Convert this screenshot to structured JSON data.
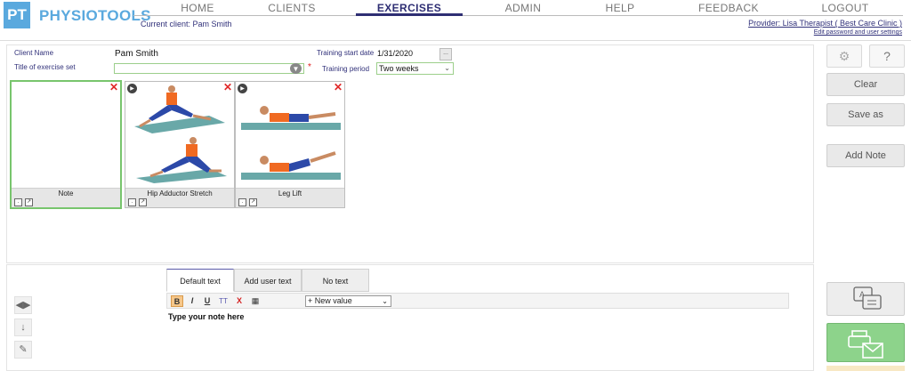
{
  "brand": {
    "logo_mark": "PT",
    "name": "PHYSIOTOOLS"
  },
  "nav": {
    "items": [
      "HOME",
      "CLIENTS",
      "EXERCISES",
      "ADMIN",
      "HELP",
      "FEEDBACK",
      "LOGOUT"
    ],
    "active": "EXERCISES"
  },
  "header": {
    "current_client": "Current client: Pam Smith",
    "provider": "Provider: Lisa Therapist ( Best Care Clinic )",
    "edit_link": "Edit password and user settings"
  },
  "form": {
    "client_name_label": "Client Name",
    "client_name_value": "Pam  Smith",
    "title_label": "Title of exercise set",
    "title_value": "",
    "required_mark": "*",
    "training_start_label": "Training start date",
    "training_start_value": "1/31/2020",
    "date_button": "...",
    "training_period_label": "Training period",
    "training_period_value": "Two weeks"
  },
  "cards": [
    {
      "caption": "Note"
    },
    {
      "caption": "Hip Adductor Stretch"
    },
    {
      "caption": "Leg Lift"
    }
  ],
  "right_buttons": {
    "clear": "Clear",
    "save_as": "Save as",
    "add_note": "Add Note"
  },
  "editor": {
    "tabs": [
      "Default text",
      "Add user text",
      "No text"
    ],
    "active_tab": "Default text",
    "toolbar": {
      "bold": "B",
      "italic": "I",
      "underline": "U",
      "font_size": "TT",
      "clear_format": "X"
    },
    "new_value_select": "+ New value",
    "content": "Type your note here"
  },
  "colors": {
    "brand_blue": "#5aa9de",
    "nav_active": "#2e2e73",
    "selected_border": "#78c56d",
    "print_green": "#8dd38b",
    "close_red": "#e02828"
  }
}
